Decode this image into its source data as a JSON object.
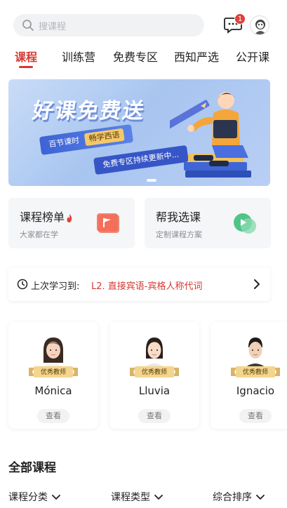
{
  "header": {
    "search_placeholder": "搜课程",
    "message_badge": "1",
    "icons": [
      "search-icon",
      "message-icon",
      "user-avatar"
    ]
  },
  "tabs": [
    {
      "label": "课程",
      "active": true
    },
    {
      "label": "训练营"
    },
    {
      "label": "免费专区"
    },
    {
      "label": "西知严选"
    },
    {
      "label": "公开课"
    }
  ],
  "banner": {
    "title": "好课免费送",
    "tag1": "百节课时",
    "tag1_gold": "畅学西语",
    "tag2": "免费专区持续更新中..."
  },
  "cards": [
    {
      "title": "课程榜单",
      "subtitle": "大家都在学",
      "icon": "flag-icon"
    },
    {
      "title": "帮我选课",
      "subtitle": "定制课程方案",
      "icon": "chat-play-icon"
    }
  ],
  "last_study": {
    "label": "上次学习到:",
    "value": "L2. 直接宾语-宾格人称代词"
  },
  "teachers": {
    "badge": "优秀教师",
    "view_label": "查看",
    "items": [
      {
        "name": "Mónica"
      },
      {
        "name": "Lluvia"
      },
      {
        "name": "Ignacio"
      }
    ]
  },
  "all_courses": {
    "title": "全部课程",
    "filters": [
      "课程分类",
      "课程类型",
      "综合排序"
    ]
  },
  "colors": {
    "accent": "#d33b33",
    "banner_blue": "#3d63d6",
    "gold": "#f3c86a"
  }
}
